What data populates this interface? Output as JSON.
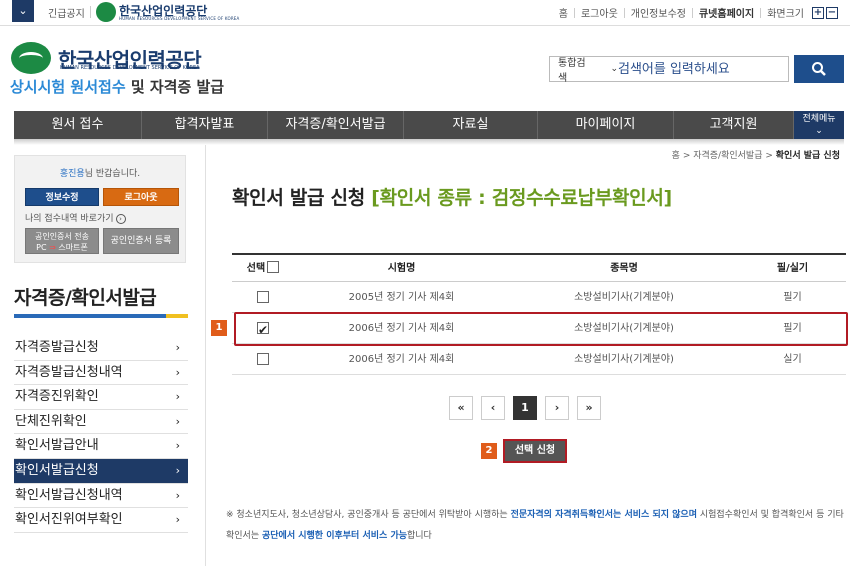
{
  "topbar": {
    "menu_toggle_glyph": "⌄",
    "urgent_notice": "긴급공지",
    "small_logo_name": "한국산업인력공단",
    "small_logo_sub": "HUMAN RESOURCES DEVELOPMENT SERVICE OF KOREA",
    "links": [
      "홈",
      "로그아웃",
      "개인정보수정",
      "큐넷홈페이지",
      "화면크기"
    ],
    "zoom_in": "+",
    "zoom_out": "−"
  },
  "header": {
    "logo_name": "한국산업인력공단",
    "logo_sub": "HUMAN RESOURCES DEVELOPMENT SERVICE OF KOREA",
    "site_title_accent": "상시시험 원서접수",
    "site_title_rest": " 및 자격증 발급",
    "search_scope": "통합검색",
    "search_placeholder": "검색어를 입력하세요"
  },
  "gnb": {
    "items": [
      "원서 접수",
      "합격자발표",
      "자격증/확인서발급",
      "자료실",
      "마이페이지",
      "고객지원"
    ],
    "all_menu": "전체메뉴"
  },
  "user_box": {
    "user_name": "홍진용",
    "greeting_suffix": "님 반갑습니다.",
    "info_button": "정보수정",
    "logout_button": "로그아웃",
    "quick_link": "나의 접수내역 바로가기",
    "cert_move_line1": "공인인증서 전송",
    "cert_move_pc": "PC",
    "cert_move_arrow": "⇒",
    "cert_move_phone": "스마트폰",
    "cert_register": "공인인증서 등록"
  },
  "lnb": {
    "title": "자격증/확인서발급",
    "items": [
      "자격증발급신청",
      "자격증발급신청내역",
      "자격증진위확인",
      "단체진위확인",
      "확인서발급안내",
      "확인서발급신청",
      "확인서발급신청내역",
      "확인서진위여부확인"
    ],
    "active_index": 5
  },
  "breadcrumb": {
    "home": "홈",
    "level1": "자격증/확인서발급",
    "current": "확인서 발급 신청"
  },
  "page": {
    "title": "확인서 발급 신청",
    "kind": "[확인서 종류 : 검정수수료납부확인서]"
  },
  "table": {
    "headers": [
      "선택",
      "시험명",
      "종목명",
      "필/실기"
    ],
    "rows": [
      {
        "exam": "2005년 정기 기사 제4회",
        "subject": "소방설비기사(기계분야)",
        "type": "필기",
        "checked": false
      },
      {
        "exam": "2006년 정기 기사 제4회",
        "subject": "소방설비기사(기계분야)",
        "type": "필기",
        "checked": true
      },
      {
        "exam": "2006년 정기 기사 제4회",
        "subject": "소방설비기사(기계분야)",
        "type": "실기",
        "checked": false
      }
    ]
  },
  "markers": {
    "first": "1",
    "second": "2"
  },
  "pager": {
    "first": "«",
    "prev": "‹",
    "current": "1",
    "next": "›",
    "last": "»"
  },
  "select_button": "선택 신청",
  "notice": {
    "p1": "※ 청소년지도사, 청소년상담사, 공인중개사 등 공단에서 위탁받아 시행하는 ",
    "h1": "전문자격의 자격취득확인서는 서비스 되지 않으며",
    "p2": " 시험접수확인서 및 합격확인서 등 기타 확인서는 ",
    "h2": "공단에서 시행한 이후부터 서비스 가능",
    "p3": "합니다"
  }
}
